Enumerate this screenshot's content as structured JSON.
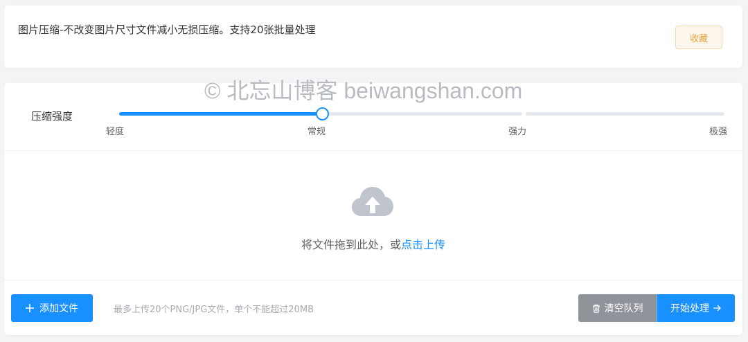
{
  "header": {
    "title": "图片压缩-不改变图片尺寸文件减小无损压缩。支持20张批量处理",
    "favorite_label": "收藏"
  },
  "compression": {
    "label": "压缩强度",
    "levels": [
      "轻度",
      "常规",
      "强力",
      "极强"
    ],
    "selected_index": 1,
    "selected_level": "常规"
  },
  "watermark": "© 北忘山博客 beiwangshan.com",
  "upload": {
    "icon": "cloud-upload-icon",
    "prompt": "将文件拖到此处，或",
    "link": "点击上传"
  },
  "footer": {
    "add_icon": "plus-icon",
    "add_label": "添加文件",
    "hint": "最多上传20个PNG/JPG文件，单个不能超过20MB",
    "clear_icon": "trash-icon",
    "clear_label": "清空队列",
    "start_label": "开始处理",
    "start_icon": "arrow-right-icon"
  },
  "colors": {
    "primary": "#1890ff",
    "warning": "#e6a23c",
    "neutral": "#909399"
  }
}
